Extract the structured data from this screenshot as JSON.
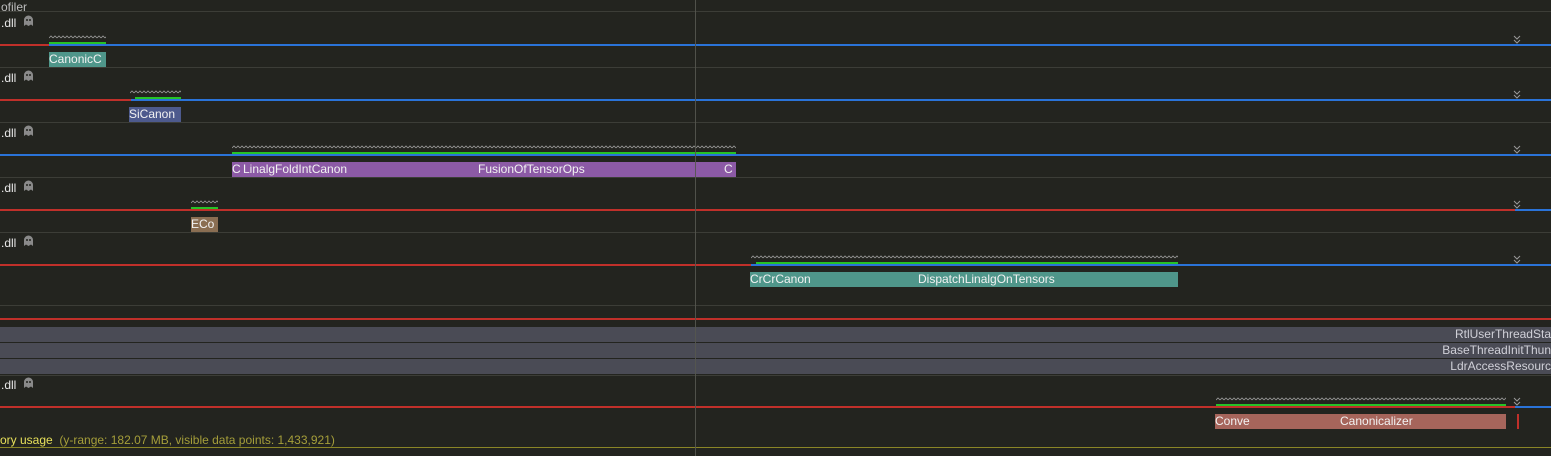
{
  "header": {
    "title": "ofiler"
  },
  "tracks": [
    {
      "module": ".dll",
      "slices": [
        {
          "label": "CanonicC",
          "color": "#4f968a"
        }
      ]
    },
    {
      "module": ".dll",
      "slices": [
        {
          "label": "SiCanon",
          "color": "#4d5a8d"
        }
      ]
    },
    {
      "module": ".dll",
      "slices": [
        {
          "label": "C",
          "color": "#8c5aa6"
        },
        {
          "label": "LinalgFoldIntCanon",
          "color": "#8c5aa6"
        },
        {
          "label": "FusionOfTensorOps",
          "color": "#8c5aa6"
        },
        {
          "label": "C",
          "color": "#8c5aa6"
        }
      ]
    },
    {
      "module": ".dll",
      "slices": [
        {
          "label": "ECo",
          "color": "#8a6e52"
        }
      ]
    },
    {
      "module": ".dll",
      "slices": [
        {
          "label": "CrCrCanon",
          "color": "#4f968a"
        },
        {
          "label": "DispatchLinalgOnTensors",
          "color": "#4f968a"
        }
      ]
    },
    {
      "module": ".dll",
      "slices": [
        {
          "label": "Conve",
          "color": "#a6655b"
        },
        {
          "label": "Canonicalizer",
          "color": "#a6655b"
        }
      ]
    }
  ],
  "thread_frames": [
    "RtlUserThreadSta",
    "BaseThreadInitThun",
    "LdrAccessResourc"
  ],
  "memory": {
    "label": "ory usage",
    "range": "(y-range: 182.07 MB, visible data points: 1,433,921)"
  },
  "colors": {
    "background": "#23241f",
    "red_line": "#c0302a",
    "blue_line": "#2a73d8",
    "active": "#27c227",
    "memory": "#e7e05a"
  }
}
